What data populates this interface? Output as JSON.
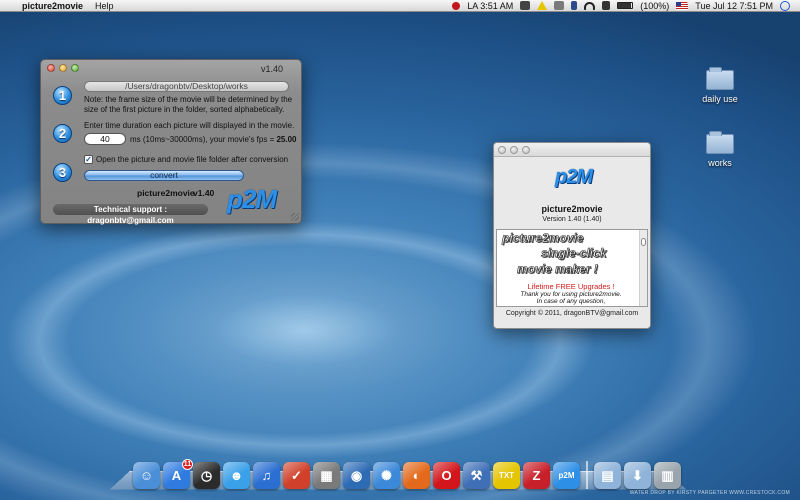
{
  "menubar": {
    "apple_icon": "apple-icon",
    "app_name": "picture2movie",
    "menus": [
      "Help"
    ],
    "clock_city": "LA 3:51 AM",
    "battery": "(100%)",
    "datetime": "Tue Jul 12  7:51 PM"
  },
  "main_window": {
    "version": "v1.40",
    "steps": [
      "1",
      "2",
      "3"
    ],
    "folder_path": "/Users/dragonbtv/Desktop/works",
    "note": "Note: the frame size of the movie will be determined by the size of the first picture in the folder, sorted alphabetically.",
    "duration_prompt": "Enter time duration each picture will displayed in the movie.",
    "duration_value": "40",
    "duration_hint": "ms (10ms~30000ms), your movie's fps = ",
    "fps_value": "25.00",
    "checkbox_checked": true,
    "checkbox_mark": "✓",
    "checkbox_label": "Open the picture and movie file folder after conversion",
    "convert_label": "convert",
    "app_title": "picture2movie",
    "app_version": "v1.40",
    "logo": "p2M",
    "support": "Technical support : dragonbtv@gmail.com"
  },
  "about_window": {
    "logo": "p2M",
    "name": "picture2movie",
    "version": "Version 1.40 (1.40)",
    "marquee": [
      "picture2movie",
      "single-click",
      "movie maker !"
    ],
    "lifetime": "Lifetime FREE Upgrades !",
    "thanks": "Thank you for using picture2movie.",
    "contact": "In case of any question,",
    "copyright": "Copyright © 2011, dragonBTV@gmail.com"
  },
  "desktop": {
    "icons": [
      {
        "label": "daily use",
        "icon": "folder-icon"
      },
      {
        "label": "works",
        "icon": "folder-icon"
      }
    ]
  },
  "dock": {
    "items": [
      {
        "name": "finder",
        "icon": "finder-icon",
        "glyph": "☺",
        "color": "#4a8fd8"
      },
      {
        "name": "app-store",
        "icon": "app-store-icon",
        "glyph": "A",
        "color": "#2f7be0",
        "badge": "11"
      },
      {
        "name": "dashboard",
        "icon": "dashboard-icon",
        "glyph": "◷",
        "color": "#2b2b2b"
      },
      {
        "name": "ichat",
        "icon": "ichat-icon",
        "glyph": "☻",
        "color": "#3aa0e8"
      },
      {
        "name": "itunes",
        "icon": "itunes-icon",
        "glyph": "♫",
        "color": "#2a6fd1"
      },
      {
        "name": "ical",
        "icon": "calendar-icon",
        "glyph": "✓",
        "color": "#d0402a"
      },
      {
        "name": "preview",
        "icon": "photo-icon",
        "glyph": "▦",
        "color": "#7a7a7a"
      },
      {
        "name": "google-earth",
        "icon": "globe-icon",
        "glyph": "◉",
        "color": "#2e6bb5"
      },
      {
        "name": "safari",
        "icon": "compass-icon",
        "glyph": "✺",
        "color": "#3c89d9"
      },
      {
        "name": "firefox",
        "icon": "firefox-icon",
        "glyph": "◐",
        "color": "#e36a1c"
      },
      {
        "name": "opera",
        "icon": "opera-icon",
        "glyph": "O",
        "color": "#d2161b"
      },
      {
        "name": "xcode",
        "icon": "hammer-icon",
        "glyph": "⚒",
        "color": "#3f6fb7"
      },
      {
        "name": "textedit",
        "icon": "txt-icon",
        "glyph": "TXT",
        "color": "#e5c400"
      },
      {
        "name": "zotero",
        "icon": "z-icon",
        "glyph": "Z",
        "color": "#c8202a"
      },
      {
        "name": "picture2movie",
        "icon": "p2m-icon",
        "glyph": "p2M",
        "color": "#2e8fe6"
      },
      {
        "name": "applications",
        "icon": "folder-icon",
        "glyph": "▤",
        "color": "#8fb3d9"
      },
      {
        "name": "downloads",
        "icon": "download-folder-icon",
        "glyph": "⬇",
        "color": "#8fb3d9"
      },
      {
        "name": "trash",
        "icon": "trash-icon",
        "glyph": "▥",
        "color": "#9aa4ad"
      }
    ],
    "credit": "WATER DROP BY KIRSTY PARGETER  WWW.CRESTOCK.COM"
  },
  "colors": {
    "accent_blue": "#2e8fe6",
    "lifetime_red": "#d31b1b"
  }
}
